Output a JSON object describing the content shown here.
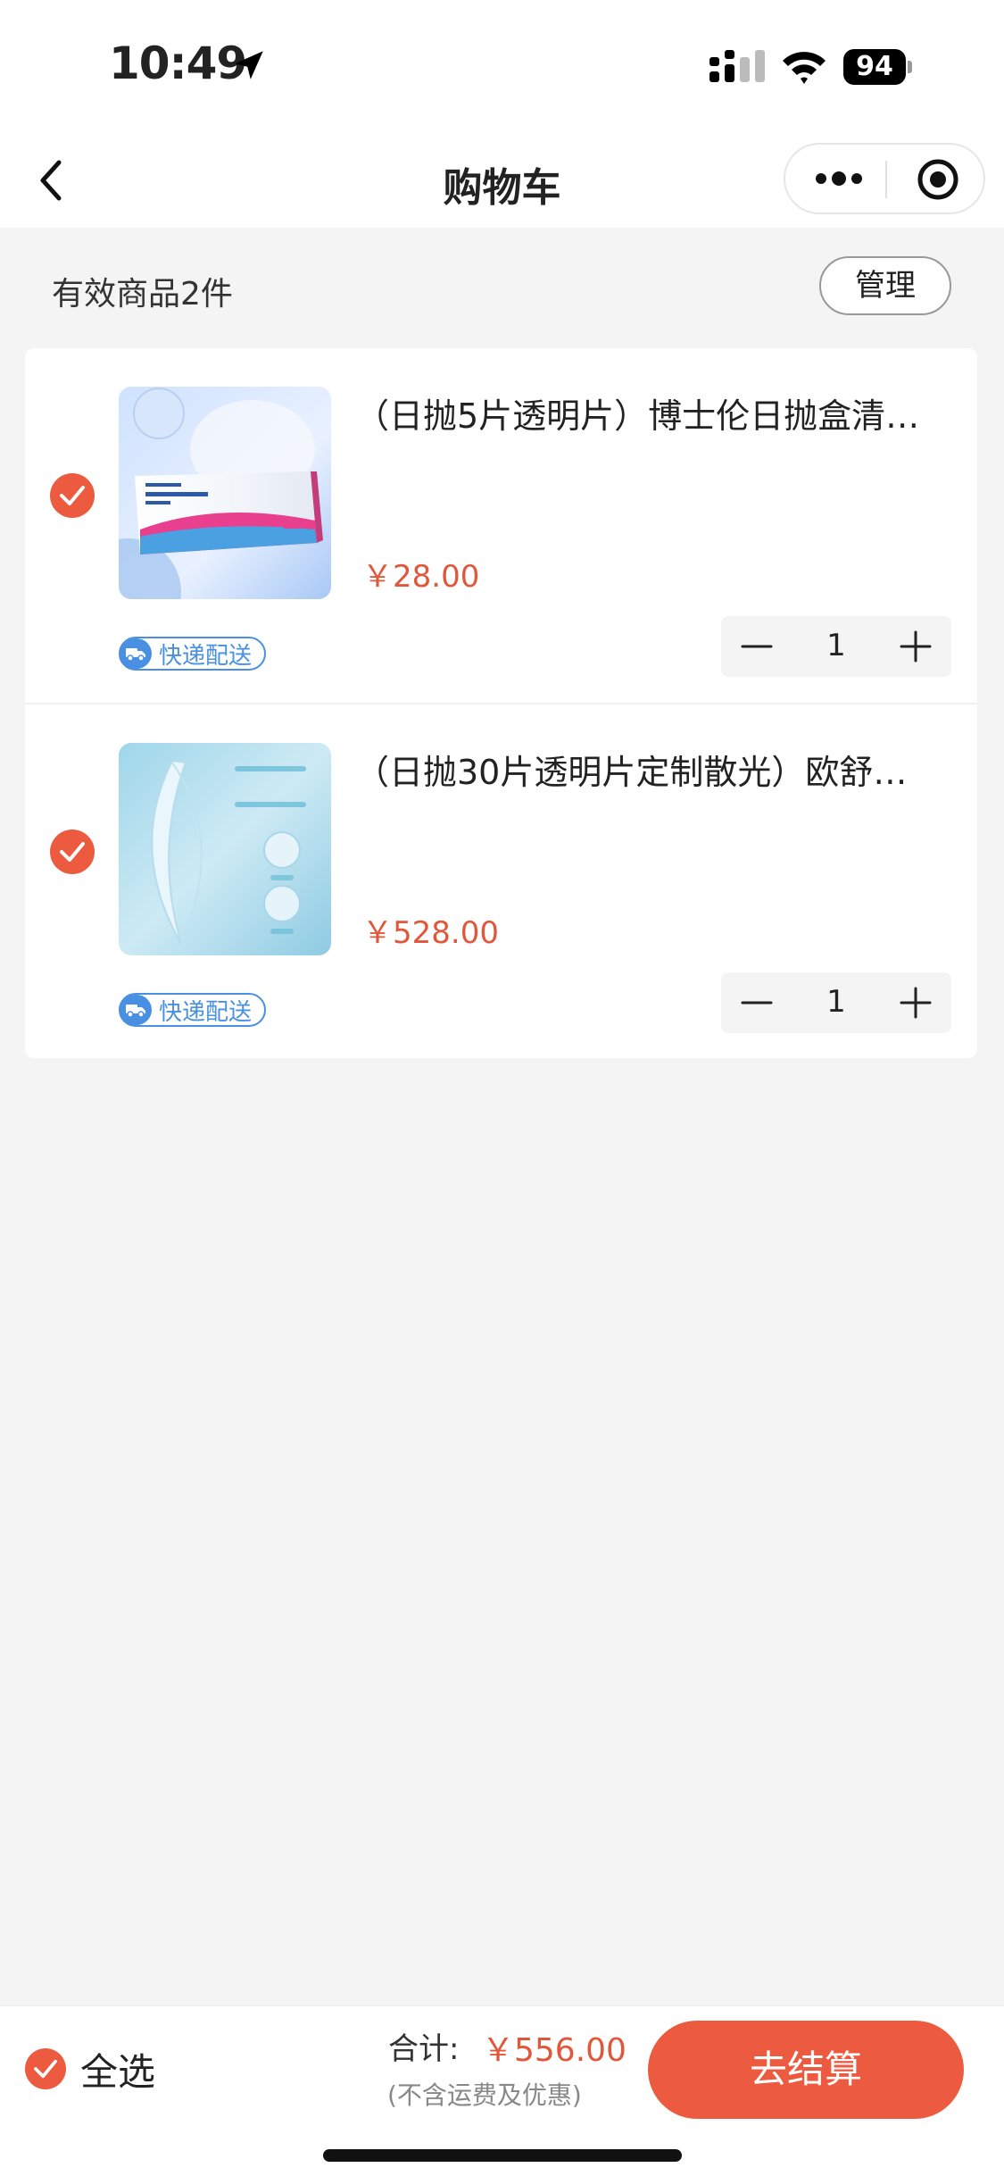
{
  "status_bar": {
    "time": "10:49",
    "battery": "94"
  },
  "nav": {
    "title": "购物车"
  },
  "cart_header": {
    "count_label": "有效商品2件",
    "manage_label": "管理"
  },
  "items": [
    {
      "title": "（日抛5片透明片）博士伦日抛盒清…",
      "price": "￥28.00",
      "tag": "快递配送",
      "quantity": "1",
      "checked": true
    },
    {
      "title": "（日抛30片透明片定制散光）欧舒…",
      "price": "￥528.00",
      "tag": "快递配送",
      "quantity": "1",
      "checked": true
    }
  ],
  "bottom_bar": {
    "select_all_label": "全选",
    "total_label": "合计:",
    "total_value": "￥556.00",
    "total_note": "(不含运费及优惠)",
    "checkout_label": "去结算"
  },
  "colors": {
    "accent": "#ec5b3f",
    "price": "#e0573c",
    "tag": "#4a90e2"
  }
}
